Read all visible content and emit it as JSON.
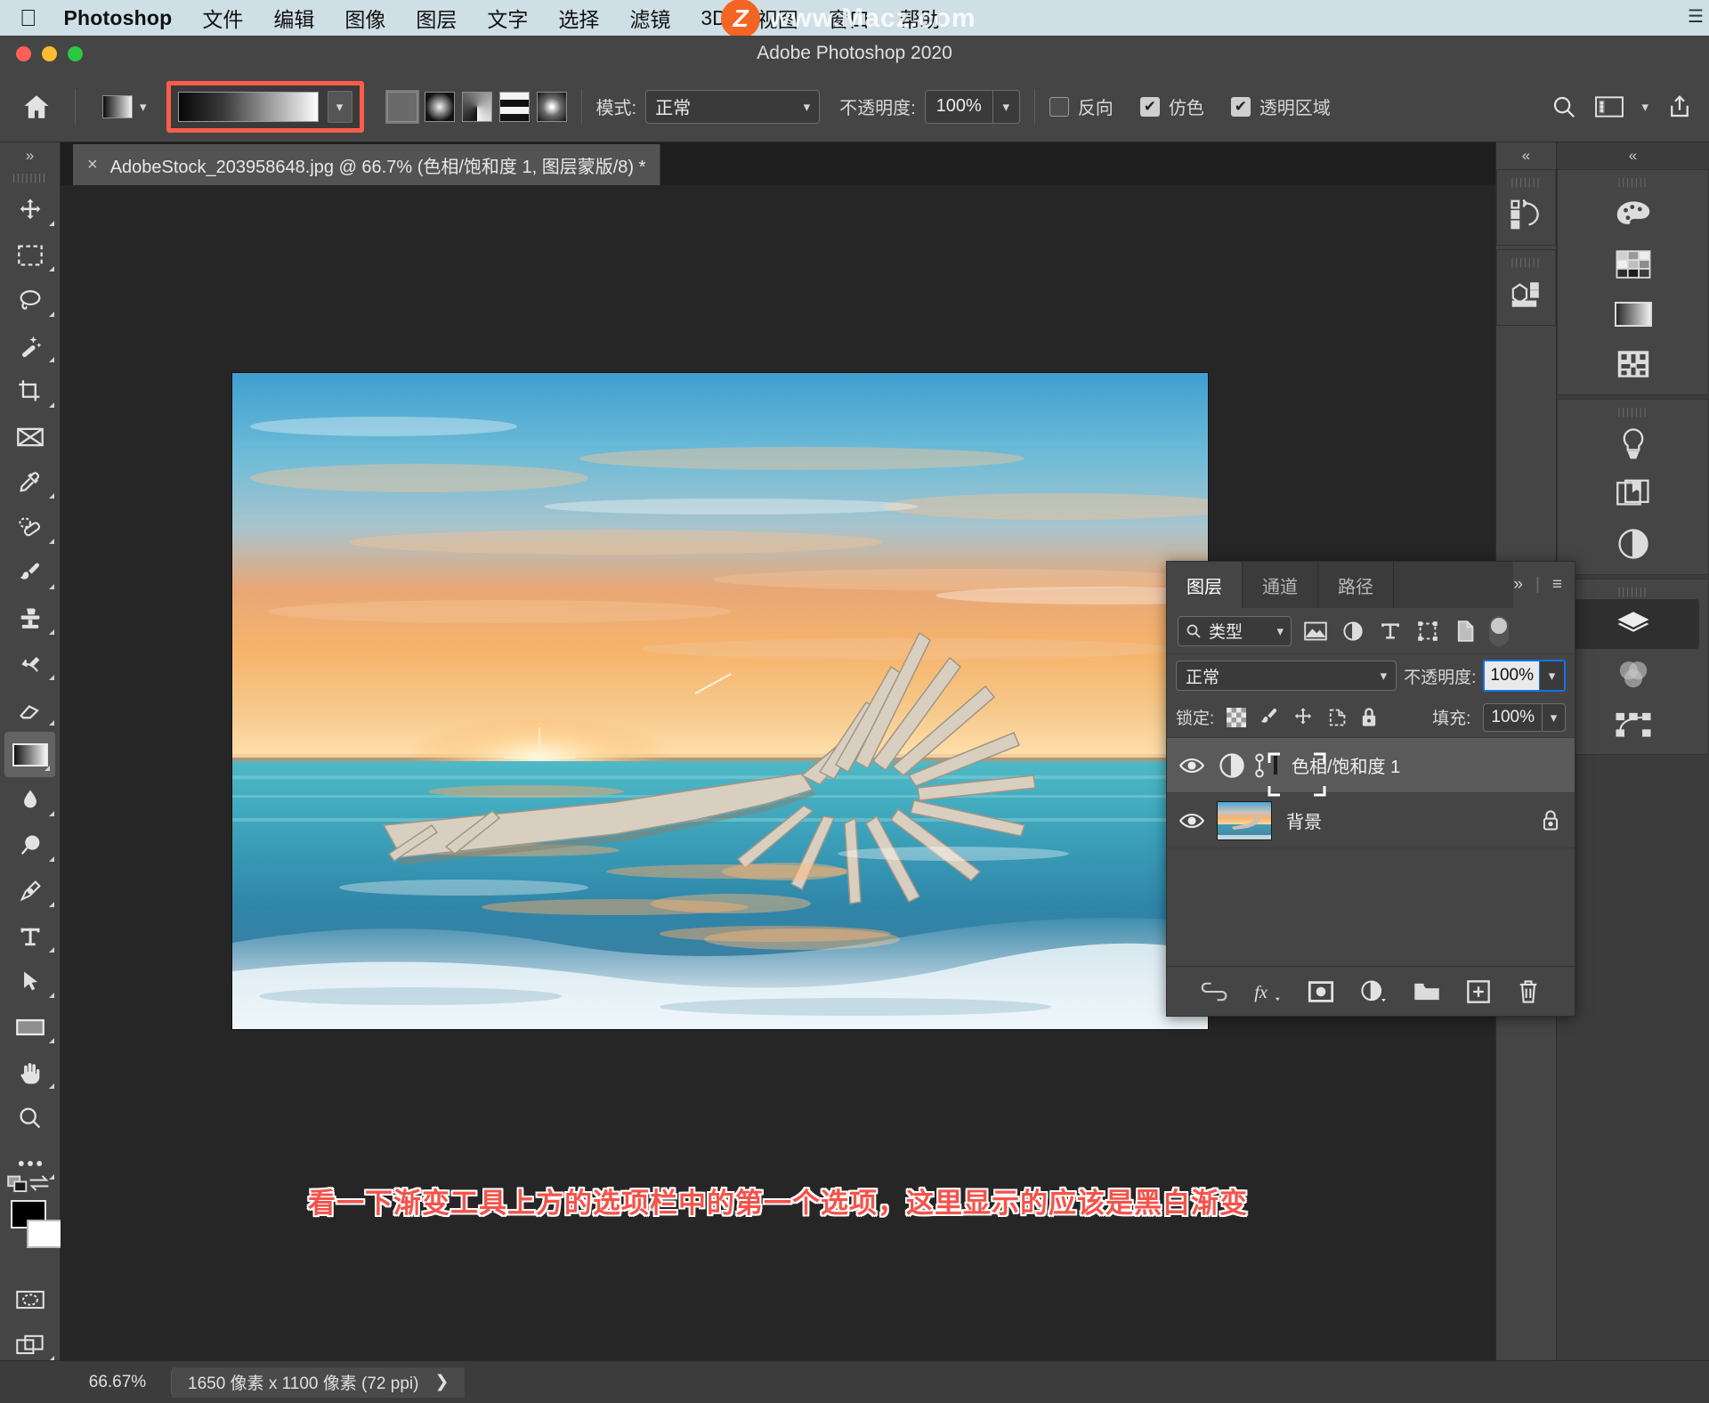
{
  "macmenu": {
    "apple": "apple-logo",
    "app": "Photoshop",
    "items": [
      "文件",
      "编辑",
      "图像",
      "图层",
      "文字",
      "选择",
      "滤镜",
      "3D",
      "视图",
      "窗口",
      "帮助"
    ]
  },
  "watermark": {
    "badge": "Z",
    "text": "www.Macz.com"
  },
  "window": {
    "title": "Adobe Photoshop 2020"
  },
  "options": {
    "home_icon": "home-icon",
    "preset_label": "gradient-preset-swatch",
    "gradient_editor_label": "gradient-editor-swatch",
    "types": [
      "线性渐变",
      "径向渐变",
      "角度渐变",
      "对称渐变",
      "菱形渐变"
    ],
    "mode_label": "模式:",
    "mode_value": "正常",
    "opacity_label": "不透明度:",
    "opacity_value": "100%",
    "reverse_label": "反向",
    "reverse_checked": false,
    "dither_label": "仿色",
    "dither_checked": true,
    "transparency_label": "透明区域",
    "transparency_checked": true,
    "right_icons": [
      "search-icon",
      "workspace-icon",
      "chevron-down-icon",
      "share-icon"
    ]
  },
  "document": {
    "tab_title": "AdobeStock_203958648.jpg @ 66.7% (色相/饱和度 1, 图层蒙版/8) *",
    "close_glyph": "×"
  },
  "toolbar": {
    "collapse_glyph": "»",
    "tools": [
      {
        "name": "move-tool",
        "label": "移动工具"
      },
      {
        "name": "marquee-tool",
        "label": "矩形选框工具"
      },
      {
        "name": "lasso-tool",
        "label": "套索工具"
      },
      {
        "name": "magic-wand-tool",
        "label": "快速选择工具"
      },
      {
        "name": "crop-tool",
        "label": "裁剪工具"
      },
      {
        "name": "frame-tool",
        "label": "画框工具"
      },
      {
        "name": "eyedropper-tool",
        "label": "吸管工具"
      },
      {
        "name": "healing-brush-tool",
        "label": "污点修复画笔工具"
      },
      {
        "name": "brush-tool",
        "label": "画笔工具"
      },
      {
        "name": "clone-stamp-tool",
        "label": "仿制图章工具"
      },
      {
        "name": "history-brush-tool",
        "label": "历史记录画笔工具"
      },
      {
        "name": "eraser-tool",
        "label": "橡皮擦工具"
      },
      {
        "name": "gradient-tool",
        "label": "渐变工具",
        "selected": true
      },
      {
        "name": "blur-tool",
        "label": "模糊工具"
      },
      {
        "name": "dodge-tool",
        "label": "减淡工具"
      },
      {
        "name": "pen-tool",
        "label": "钢笔工具"
      },
      {
        "name": "type-tool",
        "label": "横排文字工具"
      },
      {
        "name": "path-selection-tool",
        "label": "路径选择工具"
      },
      {
        "name": "rectangle-tool",
        "label": "矩形工具"
      },
      {
        "name": "hand-tool",
        "label": "抓手工具"
      },
      {
        "name": "zoom-tool",
        "label": "缩放工具"
      },
      {
        "name": "more-tools",
        "label": "编辑工具栏"
      }
    ],
    "foreground_color": "#000000",
    "background_color": "#ffffff"
  },
  "caption": "看一下渐变工具上方的选项栏中的第一个选项，这里显示的应该是黑白渐变",
  "rail_left": {
    "collapse_glyph": "«",
    "items": [
      "history-icon",
      "3d-icon"
    ]
  },
  "rail_right": {
    "collapse_glyph": "«",
    "groups": [
      [
        "color-palette-icon",
        "swatches-grid-icon",
        "gradients-icon",
        "patterns-icon"
      ],
      [
        "learn-bulb-icon",
        "libraries-icon",
        "adjustments-icon"
      ],
      [
        "layers-icon",
        "channels-icon",
        "paths-icon"
      ]
    ],
    "selected": "layers-icon"
  },
  "layers_panel": {
    "tabs": [
      {
        "label": "图层",
        "active": true
      },
      {
        "label": "通道",
        "active": false
      },
      {
        "label": "路径",
        "active": false
      }
    ],
    "expand_glyph": "»",
    "menu_glyph": "≡",
    "filter_value": "类型",
    "filter_icons": [
      "filter-pixel-icon",
      "filter-adjustment-icon",
      "filter-type-icon",
      "filter-shape-icon",
      "filter-smart-icon"
    ],
    "filter_toggle": "filter-enable-toggle",
    "blend_mode": "正常",
    "opacity_label": "不透明度:",
    "opacity_value": "100%",
    "lock_label": "锁定:",
    "lock_icons": [
      "lock-transparent-icon",
      "lock-image-icon",
      "lock-position-icon",
      "lock-artboard-icon",
      "lock-all-icon"
    ],
    "fill_label": "填充:",
    "fill_value": "100%",
    "layers": [
      {
        "name": "色相/饱和度 1",
        "visible": true,
        "selected": true,
        "kind": "adjustment",
        "locked": false
      },
      {
        "name": "背景",
        "visible": true,
        "selected": false,
        "kind": "image",
        "locked": true
      }
    ],
    "bottom_icons": [
      "link-layers-icon",
      "layer-style-fx-icon",
      "add-mask-icon",
      "new-adjustment-icon",
      "new-group-icon",
      "new-layer-icon",
      "delete-layer-icon"
    ]
  },
  "status": {
    "zoom": "66.67%",
    "doc_info": "1650 像素 x 1100 像素 (72 ppi)",
    "expand_glyph": "❯"
  },
  "colors": {
    "accent_red": "#fb5c4c",
    "focus_blue": "#1473e6",
    "panel_bg": "#454545",
    "canvas_bg": "#262626",
    "menu_bg": "#cfdfe6"
  }
}
